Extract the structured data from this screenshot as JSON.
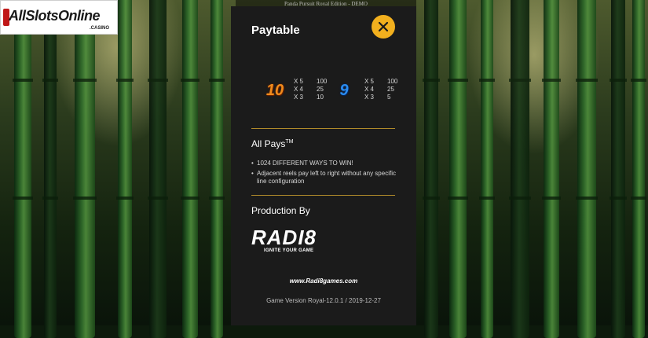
{
  "window": {
    "title": "Panda Pursuit Royal Edition - DEMO"
  },
  "watermark": {
    "brand": "AllSlotsOnline",
    "suffix": ".CASINO"
  },
  "paytable": {
    "title": "Paytable",
    "close_icon": "close-icon",
    "accent_color": "#f2b01e",
    "symbols": [
      {
        "symbol": "10",
        "color": "#f08a1c",
        "pays": [
          {
            "mult": "X 5",
            "value": "100"
          },
          {
            "mult": "X 4",
            "value": "25"
          },
          {
            "mult": "X 3",
            "value": "10"
          }
        ]
      },
      {
        "symbol": "9",
        "color": "#2a8cf0",
        "pays": [
          {
            "mult": "X 5",
            "value": "100"
          },
          {
            "mult": "X 4",
            "value": "25"
          },
          {
            "mult": "X 3",
            "value": "5"
          }
        ]
      }
    ]
  },
  "all_pays": {
    "heading": "All Pays",
    "trademark": "TM",
    "bullets": [
      "1024 DIFFERENT WAYS TO WIN!",
      "Adjacent reels pay left to right without any specific line configuration"
    ]
  },
  "production": {
    "heading": "Production By",
    "studio_logo": "RADI8",
    "studio_tagline": "IGNITE YOUR GAME",
    "website": "www.Radi8games.com",
    "version": "Game Version Royal-12.0.1 / 2019-12-27"
  }
}
